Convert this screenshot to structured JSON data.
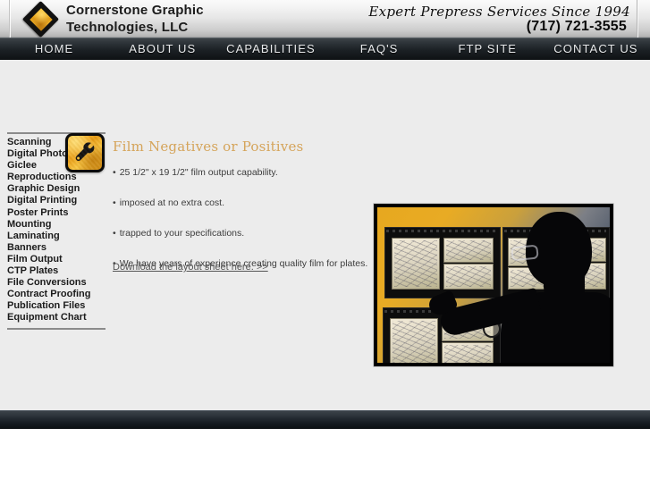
{
  "header": {
    "logo_icon": "diamond-logo-icon",
    "brand_line1": "Cornerstone Graphic",
    "brand_line2": "Technologies, LLC",
    "tagline": "Expert Prepress Services Since 1994",
    "phone": "(717) 721-3555"
  },
  "nav": {
    "items": [
      {
        "label": "HOME"
      },
      {
        "label": "ABOUT US"
      },
      {
        "label": "CAPABILITIES"
      },
      {
        "label": "FAQ'S"
      },
      {
        "label": "FTP SITE"
      },
      {
        "label": "CONTACT US"
      }
    ]
  },
  "sidebar": {
    "items": [
      {
        "label": "Scanning"
      },
      {
        "label": "Digital Photography"
      },
      {
        "label": "Giclee"
      },
      {
        "label": "Reproductions"
      },
      {
        "label": "Graphic Design"
      },
      {
        "label": "Digital Printing"
      },
      {
        "label": "Poster Prints"
      },
      {
        "label": "Mounting"
      },
      {
        "label": "Laminating"
      },
      {
        "label": "Banners"
      },
      {
        "label": "Film Output"
      },
      {
        "label": "CTP Plates"
      },
      {
        "label": "File Conversions"
      },
      {
        "label": "Contract Proofing"
      },
      {
        "label": "Publication Files"
      },
      {
        "label": "Equipment Chart"
      }
    ]
  },
  "main": {
    "service_icon": "wrench-icon",
    "title": "Film Negatives or Positives",
    "bullet_marker": "•",
    "bullets": [
      {
        "text": "25 1/2\" x 19 1/2\" film output capability."
      },
      {
        "text": "imposed at no extra cost."
      },
      {
        "text": "trapped to your specifications."
      },
      {
        "text": "We have years of experience creating quality film for plates."
      }
    ],
    "download_link": "Download the layout sheet here. >>",
    "photo_alt": "prepress-technician-reviewing-film-on-light-table"
  },
  "colors": {
    "page_background": "#ececec",
    "nav_background": "#1b2024",
    "title_gold": "#d5a45a",
    "logo_gold": "#f0b429",
    "body_text": "#3d3d3d",
    "link_gray": "#555555"
  }
}
